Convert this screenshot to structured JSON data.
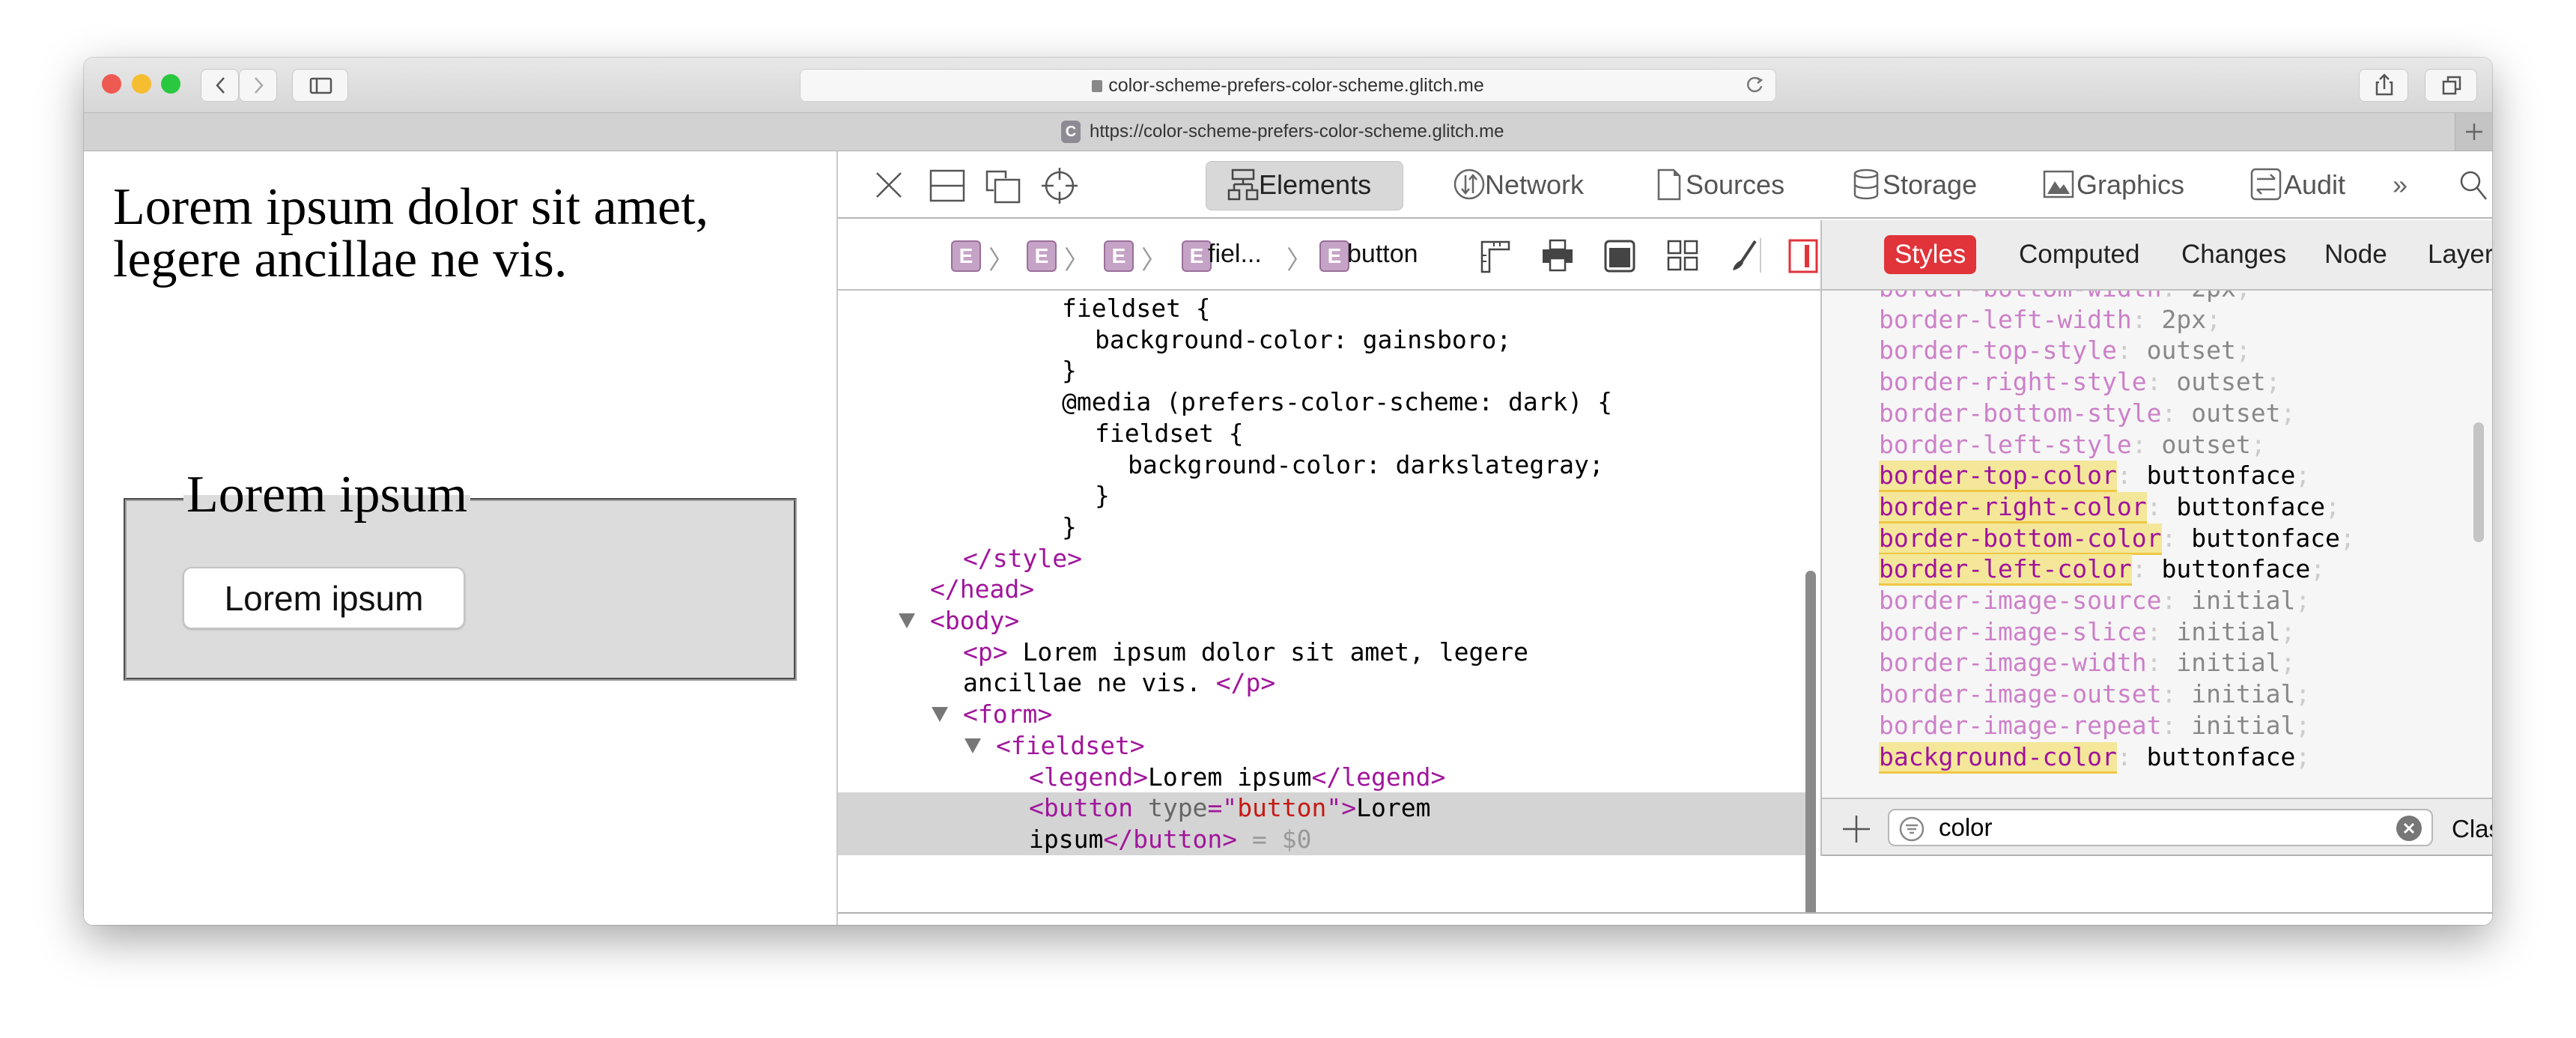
{
  "browser": {
    "address": "color-scheme-prefers-color-scheme.glitch.me",
    "tab_favicon": "C",
    "tab_title": "https://color-scheme-prefers-color-scheme.glitch.me",
    "traffic_lights": [
      "#ee5a52",
      "#f5bd2f",
      "#2ac840"
    ]
  },
  "page": {
    "paragraph": "Lorem ipsum dolor sit amet, legere ancillae ne vis.",
    "legend": "Lorem ipsum",
    "button": "Lorem ipsum"
  },
  "devtools": {
    "tabs": [
      {
        "label": "Elements",
        "icon": "elements-icon",
        "active": true
      },
      {
        "label": "Network",
        "icon": "network-icon"
      },
      {
        "label": "Sources",
        "icon": "sources-icon"
      },
      {
        "label": "Storage",
        "icon": "storage-icon"
      },
      {
        "label": "Graphics",
        "icon": "graphics-icon"
      },
      {
        "label": "Audit",
        "icon": "audit-icon"
      }
    ],
    "more": "»",
    "breadcrumb": [
      {
        "badge": "E",
        "label": ""
      },
      {
        "badge": "E",
        "label": ""
      },
      {
        "badge": "E",
        "label": ""
      },
      {
        "badge": "E",
        "label": "fiel..."
      },
      {
        "badge": "E",
        "label": "button"
      }
    ],
    "dom_lines": [
      {
        "indent": 4,
        "tokens": [
          {
            "k": "text",
            "t": "fieldset {"
          }
        ]
      },
      {
        "indent": 5,
        "tokens": [
          {
            "k": "text",
            "t": "background-color: gainsboro;"
          }
        ]
      },
      {
        "indent": 4,
        "tokens": [
          {
            "k": "text",
            "t": "}"
          }
        ]
      },
      {
        "indent": 4,
        "tokens": [
          {
            "k": "text",
            "t": "@media (prefers-color-scheme: dark) {"
          }
        ]
      },
      {
        "indent": 5,
        "tokens": [
          {
            "k": "text",
            "t": "fieldset {"
          }
        ]
      },
      {
        "indent": 6,
        "tokens": [
          {
            "k": "text",
            "t": "background-color: darkslategray;"
          }
        ]
      },
      {
        "indent": 5,
        "tokens": [
          {
            "k": "text",
            "t": "}"
          }
        ]
      },
      {
        "indent": 4,
        "tokens": [
          {
            "k": "text",
            "t": "}"
          }
        ]
      },
      {
        "indent": 1,
        "tokens": [
          {
            "k": "tag",
            "t": "</style>"
          }
        ]
      },
      {
        "indent": 0,
        "tokens": [
          {
            "k": "tag",
            "t": "</head>"
          }
        ]
      },
      {
        "indent": 0,
        "expanded": true,
        "tokens": [
          {
            "k": "tag",
            "t": "<body>"
          }
        ]
      },
      {
        "indent": 1,
        "tokens": [
          {
            "k": "tag",
            "t": "<p>"
          },
          {
            "k": "text",
            "t": " Lorem ipsum dolor sit amet, legere"
          }
        ]
      },
      {
        "indent": 1,
        "tokens": [
          {
            "k": "text",
            "t": "ancillae ne vis. "
          },
          {
            "k": "tag",
            "t": "</p>"
          }
        ]
      },
      {
        "indent": 1,
        "expanded": true,
        "tokens": [
          {
            "k": "tag",
            "t": "<form>"
          }
        ]
      },
      {
        "indent": 2,
        "expanded": true,
        "tokens": [
          {
            "k": "tag",
            "t": "<fieldset>"
          }
        ]
      },
      {
        "indent": 3,
        "tokens": [
          {
            "k": "tag",
            "t": "<legend>"
          },
          {
            "k": "text",
            "t": "Lorem ipsum"
          },
          {
            "k": "tag",
            "t": "</legend>"
          }
        ]
      },
      {
        "indent": 3,
        "selected": true,
        "tokens": [
          {
            "k": "tag",
            "t": "<button "
          },
          {
            "k": "attr",
            "t": "type"
          },
          {
            "k": "tag",
            "t": "=\""
          },
          {
            "k": "val",
            "t": "button"
          },
          {
            "k": "tag",
            "t": "\">"
          },
          {
            "k": "text",
            "t": "Lorem"
          }
        ]
      },
      {
        "indent": 3,
        "selected": true,
        "tokens": [
          {
            "k": "text",
            "t": "ipsum"
          },
          {
            "k": "tag",
            "t": "</button>"
          },
          {
            "k": "dim",
            "t": " = $0"
          }
        ]
      }
    ],
    "sidebar_tabs": [
      "Styles",
      "Computed",
      "Changes",
      "Node",
      "Layers"
    ],
    "active_sidebar_tab": "Styles",
    "properties": [
      {
        "name": "border-bottom-width",
        "value": "2px",
        "match": false
      },
      {
        "name": "border-left-width",
        "value": "2px",
        "match": false
      },
      {
        "name": "border-top-style",
        "value": "outset",
        "match": false
      },
      {
        "name": "border-right-style",
        "value": "outset",
        "match": false
      },
      {
        "name": "border-bottom-style",
        "value": "outset",
        "match": false
      },
      {
        "name": "border-left-style",
        "value": "outset",
        "match": false
      },
      {
        "name": "border-top-color",
        "value": "buttonface",
        "match": true
      },
      {
        "name": "border-right-color",
        "value": "buttonface",
        "match": true
      },
      {
        "name": "border-bottom-color",
        "value": "buttonface",
        "match": true
      },
      {
        "name": "border-left-color",
        "value": "buttonface",
        "match": true
      },
      {
        "name": "border-image-source",
        "value": "initial",
        "match": false
      },
      {
        "name": "border-image-slice",
        "value": "initial",
        "match": false
      },
      {
        "name": "border-image-width",
        "value": "initial",
        "match": false
      },
      {
        "name": "border-image-outset",
        "value": "initial",
        "match": false
      },
      {
        "name": "border-image-repeat",
        "value": "initial",
        "match": false
      },
      {
        "name": "background-color",
        "value": "buttonface",
        "match": true
      }
    ],
    "filter": {
      "value": "color",
      "classes_label": "Classes"
    },
    "console_prompt": "›",
    "accent": "#e0333a"
  }
}
